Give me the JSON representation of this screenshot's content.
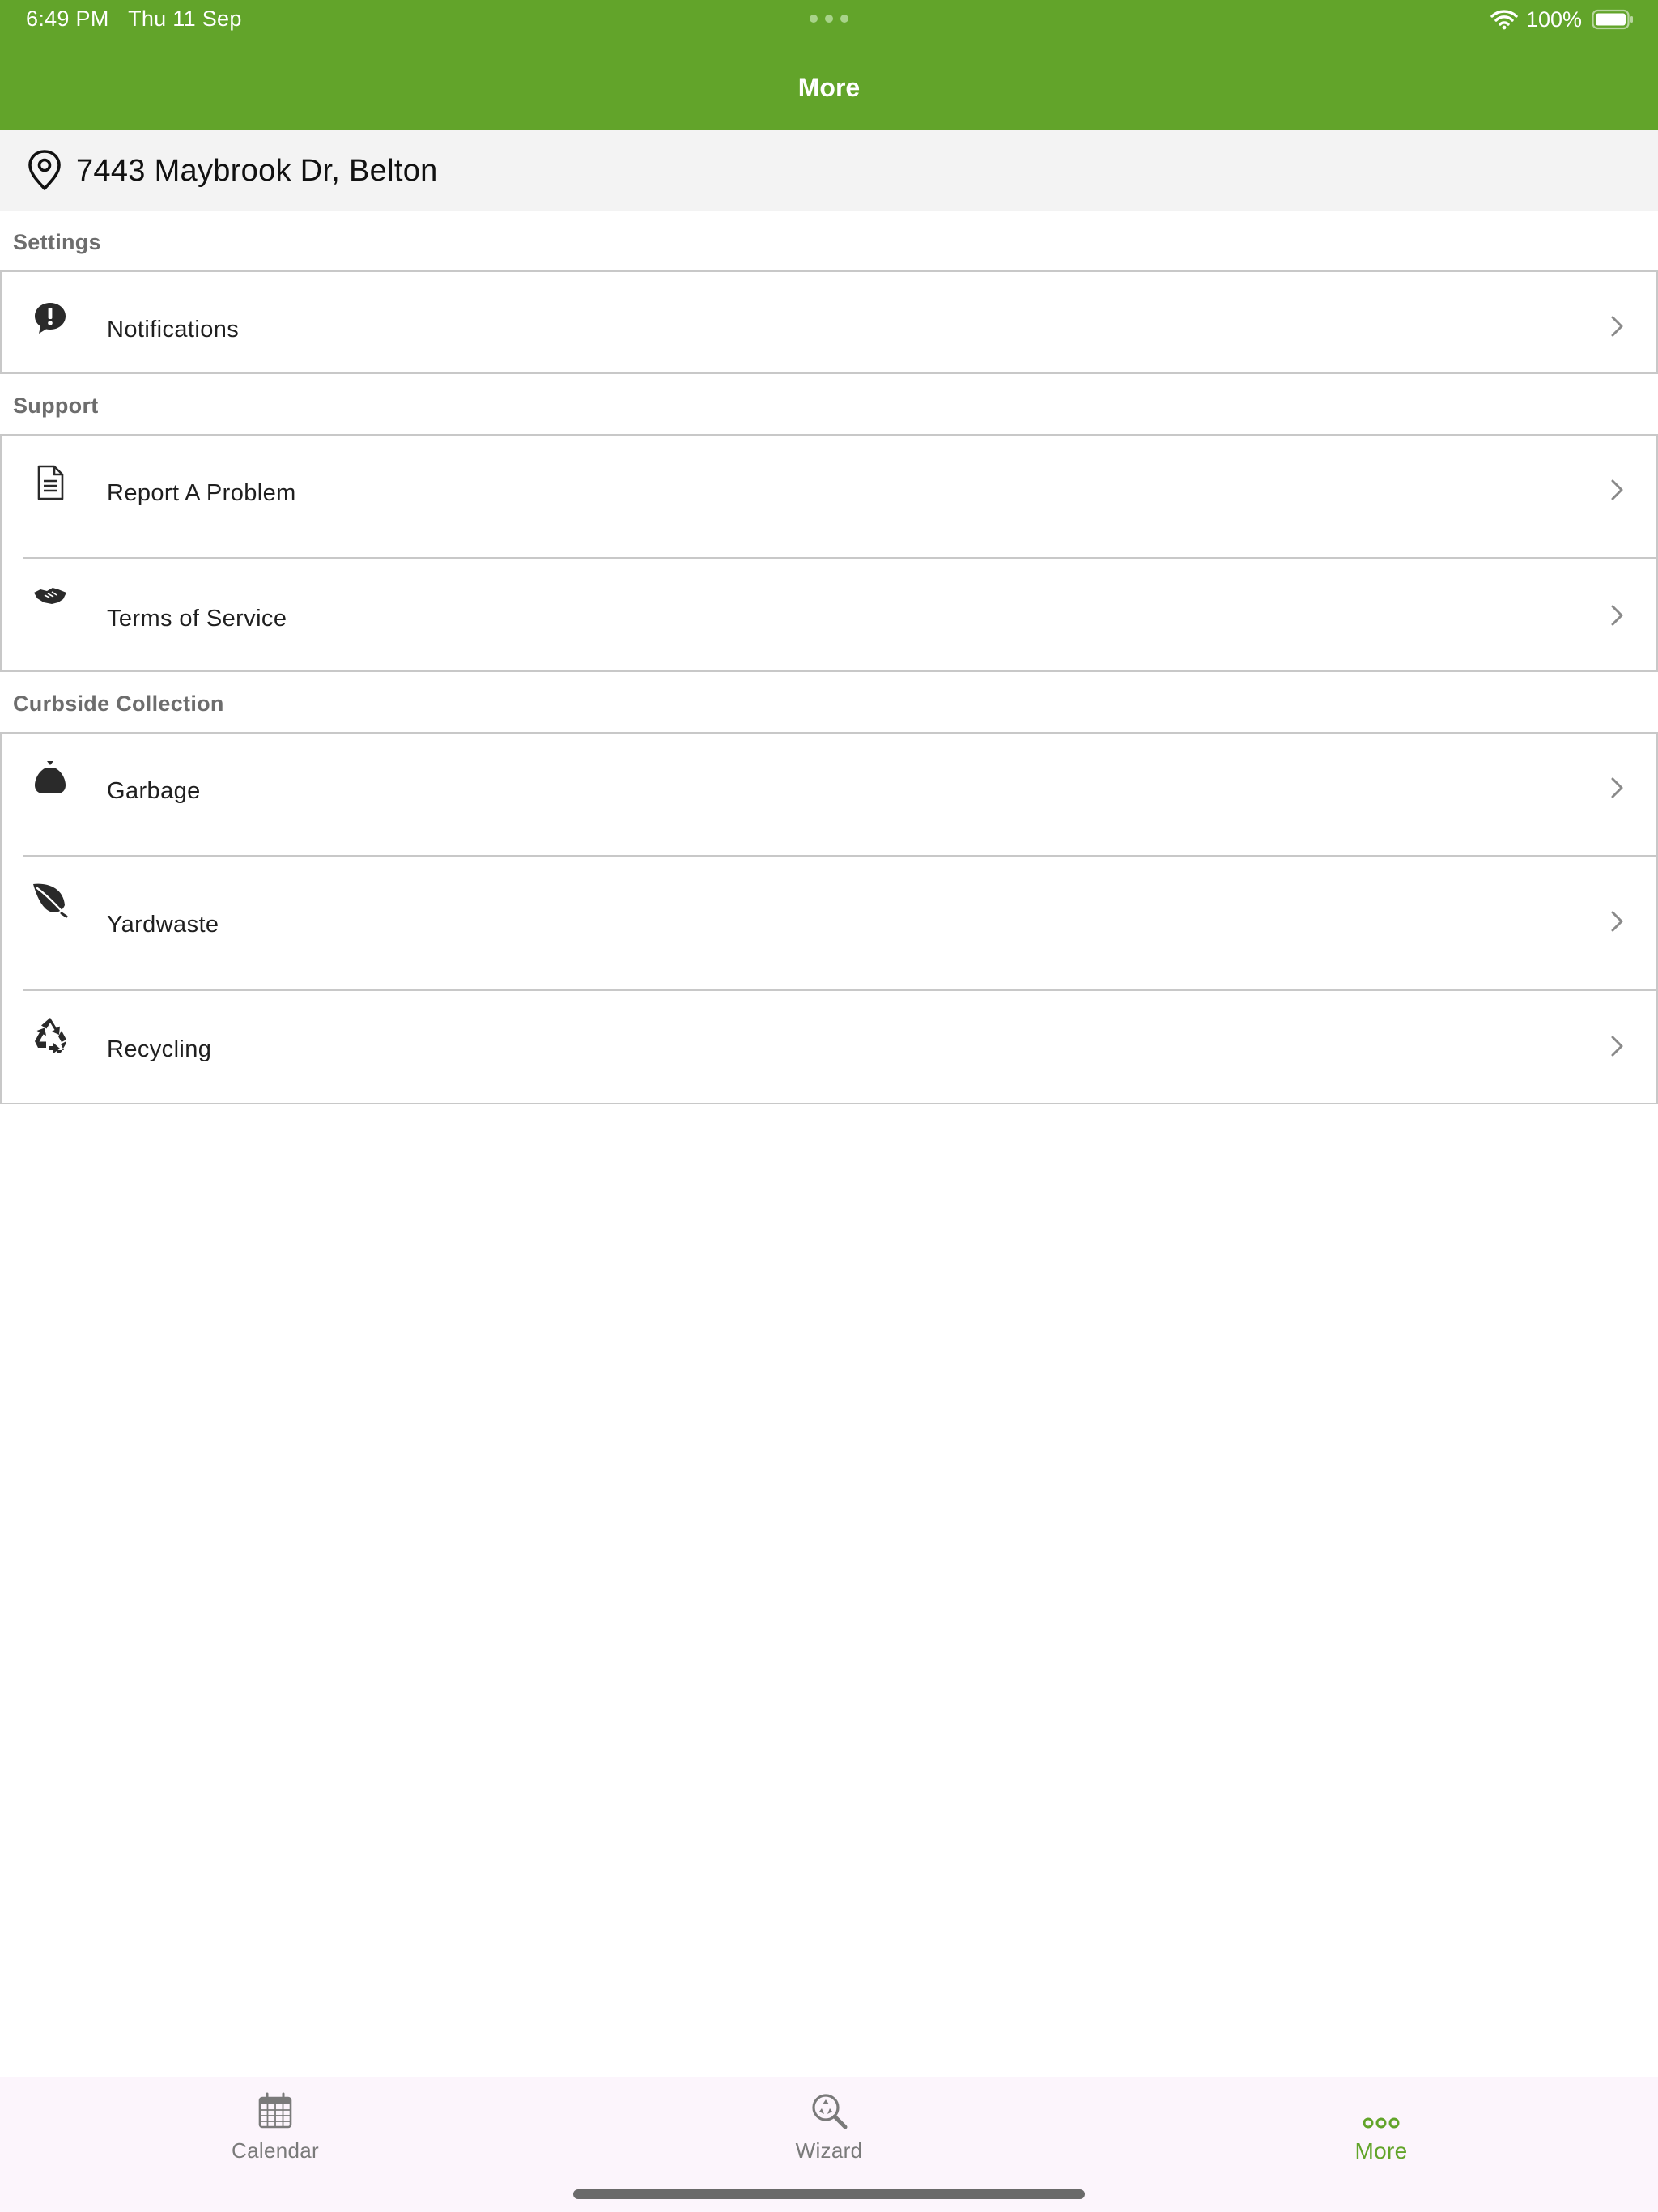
{
  "status_bar": {
    "time": "6:49 PM",
    "date": "Thu 11 Sep",
    "battery": "100%",
    "icons": [
      "wifi-icon",
      "battery-icon"
    ]
  },
  "nav": {
    "title": "More"
  },
  "address": {
    "icon": "location-pin-icon",
    "text": "7443 Maybrook Dr, Belton"
  },
  "sections": {
    "settings": {
      "title": "Settings",
      "items": [
        {
          "label": "Notifications",
          "icon": "alert-bubble-icon"
        }
      ]
    },
    "support": {
      "title": "Support",
      "items": [
        {
          "label": "Report A Problem",
          "icon": "document-icon"
        },
        {
          "label": "Terms of Service",
          "icon": "handshake-icon"
        }
      ]
    },
    "curbside": {
      "title": "Curbside Collection",
      "items": [
        {
          "label": "Garbage",
          "icon": "garbage-bag-icon"
        },
        {
          "label": "Yardwaste",
          "icon": "leaf-icon"
        },
        {
          "label": "Recycling",
          "icon": "recycle-icon"
        }
      ]
    }
  },
  "tab_bar": {
    "tabs": [
      {
        "label": "Calendar",
        "icon": "calendar-icon",
        "active": false
      },
      {
        "label": "Wizard",
        "icon": "magnifier-recycle-icon",
        "active": false
      },
      {
        "label": "More",
        "icon": "more-dots-icon",
        "active": true
      }
    ]
  },
  "colors": {
    "brand_green": "#62a42a",
    "section_header_gray": "#6d6d6d",
    "address_background": "#f3f3f3",
    "tab_bar_background": "#fcf5fc"
  }
}
